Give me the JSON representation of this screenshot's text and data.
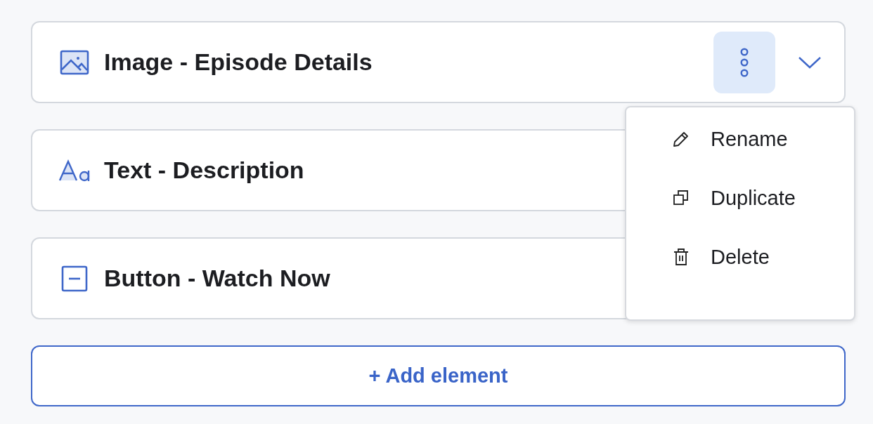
{
  "elements": [
    {
      "kind": "image",
      "label": "Image - Episode Details",
      "menu_open": true
    },
    {
      "kind": "text",
      "label": "Text - Description",
      "menu_open": false
    },
    {
      "kind": "button",
      "label": "Button - Watch Now",
      "menu_open": false
    }
  ],
  "menu": [
    {
      "kind": "rename",
      "label": "Rename"
    },
    {
      "kind": "duplicate",
      "label": "Duplicate"
    },
    {
      "kind": "delete",
      "label": "Delete"
    }
  ],
  "add_button": {
    "label": "+ Add element"
  }
}
